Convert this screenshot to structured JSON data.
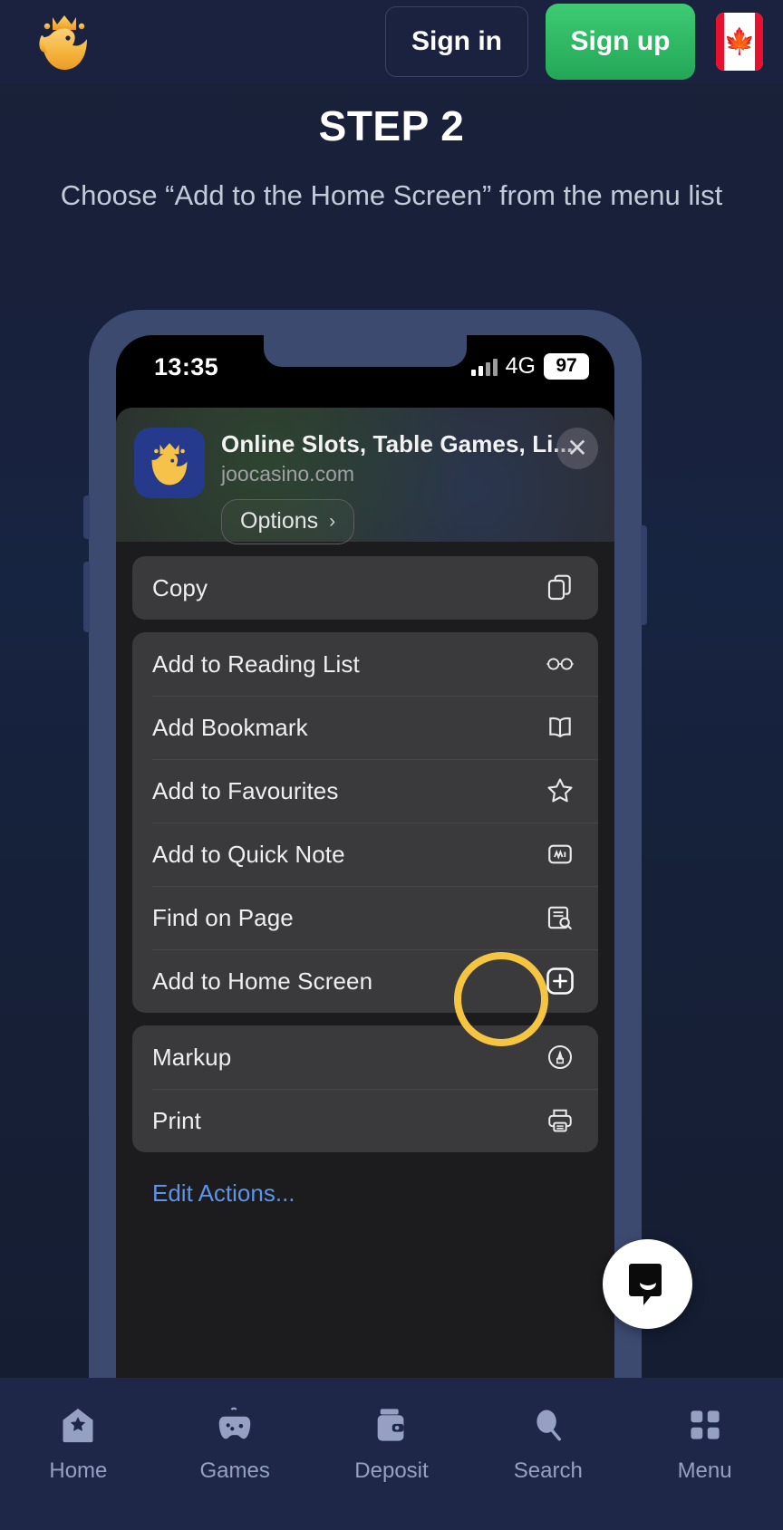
{
  "header": {
    "logo_icon": "joo-fish-crown-logo",
    "sign_in_label": "Sign in",
    "sign_up_label": "Sign up",
    "flag_icon": "canada-flag-icon",
    "flag_label": "CA",
    "accent_green": "#2eb45f",
    "accent_yellow": "#f5c542"
  },
  "instructions": {
    "step_title": "STEP 2",
    "step_description": "Choose “Add to the Home Screen” from the menu list"
  },
  "phone": {
    "status_bar": {
      "time": "13:35",
      "signal_icon": "cellular-signal-icon",
      "network": "4G",
      "battery": "97"
    },
    "share_sheet": {
      "app_icon": "joo-casino-app-icon",
      "title": "Online Slots, Table Games, Li...",
      "url": "joocasino.com",
      "options_label": "Options",
      "options_chevron_icon": "chevron-right-icon",
      "close_icon": "close-icon",
      "groups": [
        {
          "items": [
            {
              "label": "Copy",
              "icon": "copy-icon"
            }
          ]
        },
        {
          "items": [
            {
              "label": "Add to Reading List",
              "icon": "glasses-icon"
            },
            {
              "label": "Add Bookmark",
              "icon": "book-icon"
            },
            {
              "label": "Add to Favourites",
              "icon": "star-icon"
            },
            {
              "label": "Add to Quick Note",
              "icon": "quick-note-icon"
            },
            {
              "label": "Find on Page",
              "icon": "find-on-page-icon"
            },
            {
              "label": "Add to Home Screen",
              "icon": "plus-square-icon",
              "highlighted": true
            }
          ]
        },
        {
          "items": [
            {
              "label": "Markup",
              "icon": "markup-pen-icon"
            },
            {
              "label": "Print",
              "icon": "printer-icon"
            }
          ]
        }
      ],
      "edit_actions_label": "Edit Actions..."
    }
  },
  "chat": {
    "icon": "chat-bubble-icon"
  },
  "bottom_nav": [
    {
      "label": "Home",
      "icon": "home-star-icon"
    },
    {
      "label": "Games",
      "icon": "gamepad-icon"
    },
    {
      "label": "Deposit",
      "icon": "wallet-icon"
    },
    {
      "label": "Search",
      "icon": "search-icon"
    },
    {
      "label": "Menu",
      "icon": "grid-menu-icon"
    }
  ]
}
